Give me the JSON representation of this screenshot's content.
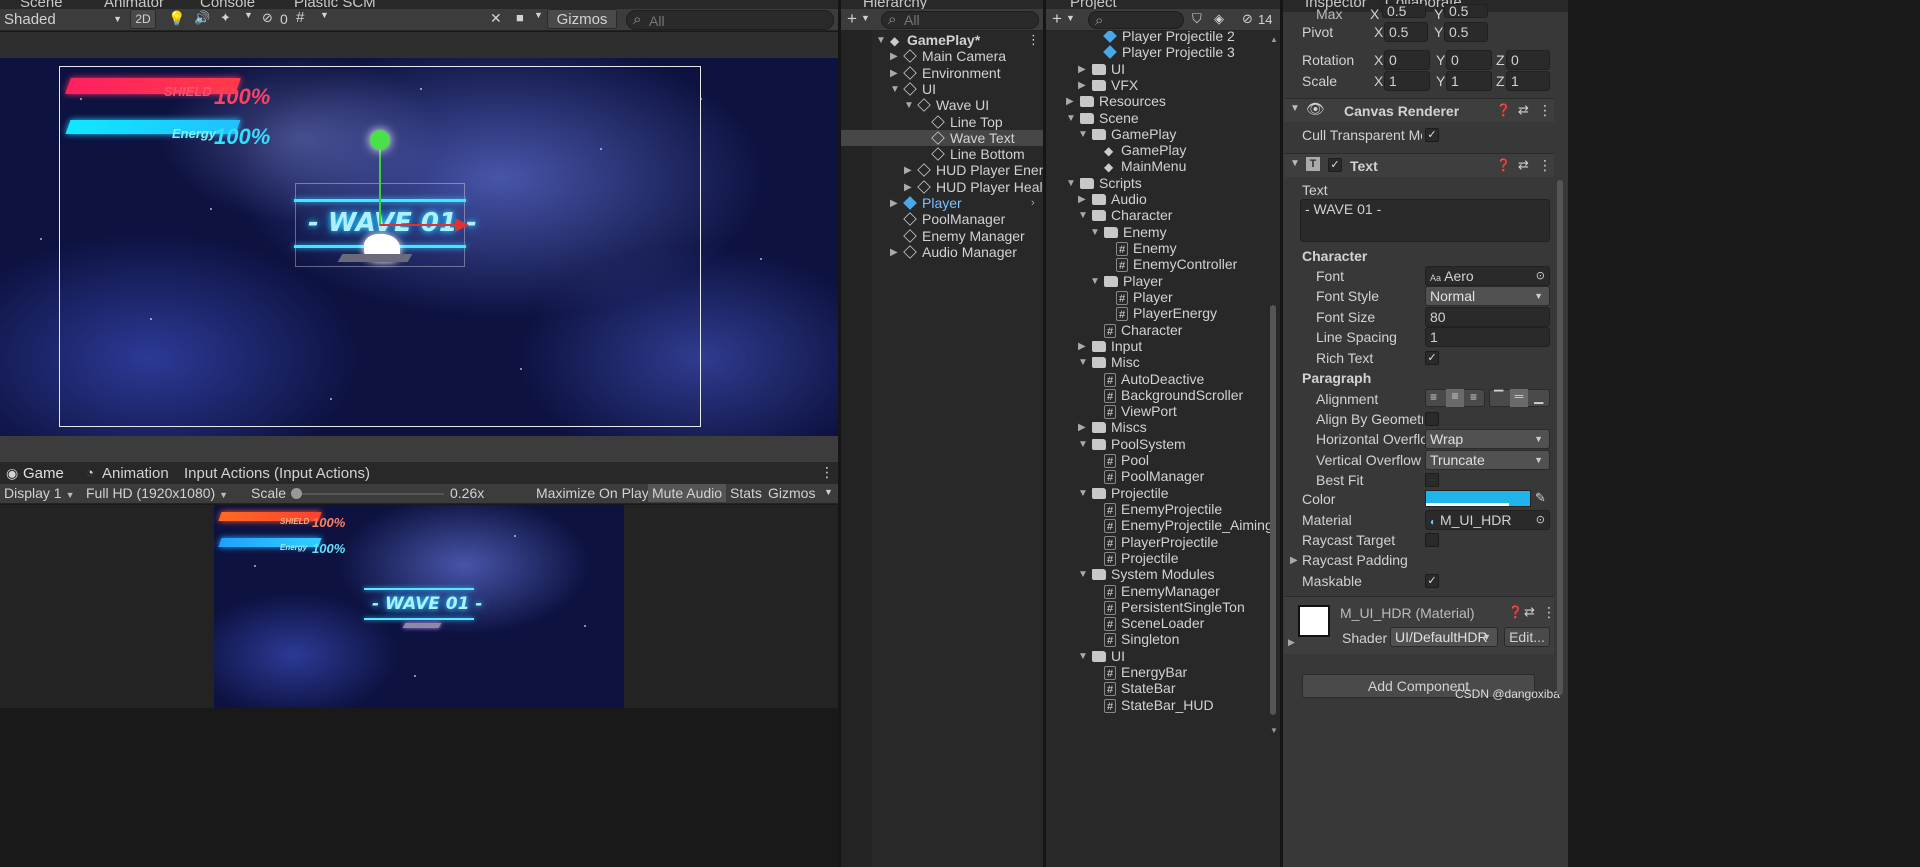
{
  "scene_panel": {
    "tabs": [
      "Scene",
      "Animator",
      "Console",
      "Plastic SCM"
    ],
    "shading_mode": "Shaded",
    "mode_2d": "2D",
    "hidden_count": "0",
    "gizmos_label": "Gizmos",
    "search_placeholder": "All",
    "hud": {
      "shield_label": "SHIELD",
      "shield_value": "100%",
      "energy_label": "Energy",
      "energy_value": "100%",
      "wave_text": "- WAVE 01 -"
    }
  },
  "game_panel": {
    "tabs": [
      "Game",
      "Animation",
      "Input Actions (Input Actions)"
    ],
    "display": "Display 1",
    "resolution": "Full HD (1920x1080)",
    "scale_label": "Scale",
    "scale_value": "0.26x",
    "scale_fraction": 0.0,
    "maximize_on_play": "Maximize On Play",
    "mute_audio": "Mute Audio",
    "stats": "Stats",
    "gizmos": "Gizmos",
    "hud": {
      "shield_label": "SHIELD",
      "shield_value": "100%",
      "energy_label": "Energy",
      "energy_value": "100%",
      "wave_text": "- WAVE 01 -"
    }
  },
  "hierarchy": {
    "title": "Hierarchy",
    "search_placeholder": "All",
    "items": [
      {
        "label": "GamePlay*",
        "depth": 0,
        "expanded": true,
        "icon": "unity-scene-icon",
        "bold": true
      },
      {
        "label": "Main Camera",
        "depth": 1,
        "expanded": false,
        "icon": "cube-icon"
      },
      {
        "label": "Environment",
        "depth": 1,
        "expanded": false,
        "icon": "cube-icon"
      },
      {
        "label": "UI",
        "depth": 1,
        "expanded": true,
        "icon": "cube-icon"
      },
      {
        "label": "Wave UI",
        "depth": 2,
        "expanded": true,
        "icon": "cube-icon"
      },
      {
        "label": "Line Top",
        "depth": 3,
        "icon": "cube-icon"
      },
      {
        "label": "Wave Text",
        "depth": 3,
        "icon": "cube-icon",
        "selected": true
      },
      {
        "label": "Line Bottom",
        "depth": 3,
        "icon": "cube-icon"
      },
      {
        "label": "HUD Player Energy",
        "depth": 2,
        "expanded": false,
        "icon": "cube-icon"
      },
      {
        "label": "HUD Player Health",
        "depth": 2,
        "expanded": false,
        "icon": "cube-icon"
      },
      {
        "label": "Player",
        "depth": 1,
        "expanded": false,
        "icon": "prefab-icon",
        "prefab": true
      },
      {
        "label": "PoolManager",
        "depth": 1,
        "icon": "cube-icon"
      },
      {
        "label": "Enemy Manager",
        "depth": 1,
        "icon": "cube-icon"
      },
      {
        "label": "Audio Manager",
        "depth": 1,
        "expanded": false,
        "icon": "cube-icon"
      }
    ]
  },
  "project": {
    "title": "Project",
    "badge_count": "14",
    "items": [
      {
        "label": "Player Projectile 2",
        "depth": 3,
        "icon": "prefab-icon"
      },
      {
        "label": "Player Projectile 3",
        "depth": 3,
        "icon": "prefab-icon"
      },
      {
        "label": "UI",
        "depth": 2,
        "expanded": false,
        "icon": "folder-icon"
      },
      {
        "label": "VFX",
        "depth": 2,
        "expanded": false,
        "icon": "folder-icon"
      },
      {
        "label": "Resources",
        "depth": 1,
        "expanded": false,
        "icon": "folder-icon"
      },
      {
        "label": "Scene",
        "depth": 1,
        "expanded": true,
        "icon": "folder-icon"
      },
      {
        "label": "GamePlay",
        "depth": 2,
        "expanded": true,
        "icon": "folder-icon"
      },
      {
        "label": "GamePlay",
        "depth": 3,
        "icon": "unity-scene-icon"
      },
      {
        "label": "MainMenu",
        "depth": 3,
        "icon": "unity-scene-icon"
      },
      {
        "label": "Scripts",
        "depth": 1,
        "expanded": true,
        "icon": "folder-icon"
      },
      {
        "label": "Audio",
        "depth": 2,
        "expanded": false,
        "icon": "folder-icon"
      },
      {
        "label": "Character",
        "depth": 2,
        "expanded": true,
        "icon": "folder-icon"
      },
      {
        "label": "Enemy",
        "depth": 3,
        "expanded": true,
        "icon": "folder-icon"
      },
      {
        "label": "Enemy",
        "depth": 4,
        "icon": "script-icon"
      },
      {
        "label": "EnemyController",
        "depth": 4,
        "icon": "script-icon"
      },
      {
        "label": "Player",
        "depth": 3,
        "expanded": true,
        "icon": "folder-icon"
      },
      {
        "label": "Player",
        "depth": 4,
        "icon": "script-icon"
      },
      {
        "label": "PlayerEnergy",
        "depth": 4,
        "icon": "script-icon"
      },
      {
        "label": "Character",
        "depth": 3,
        "icon": "script-icon"
      },
      {
        "label": "Input",
        "depth": 2,
        "expanded": false,
        "icon": "folder-icon"
      },
      {
        "label": "Misc",
        "depth": 2,
        "expanded": true,
        "icon": "folder-icon"
      },
      {
        "label": "AutoDeactive",
        "depth": 3,
        "icon": "script-icon"
      },
      {
        "label": "BackgroundScroller",
        "depth": 3,
        "icon": "script-icon"
      },
      {
        "label": "ViewPort",
        "depth": 3,
        "icon": "script-icon"
      },
      {
        "label": "Miscs",
        "depth": 2,
        "expanded": false,
        "icon": "folder-icon"
      },
      {
        "label": "PoolSystem",
        "depth": 2,
        "expanded": true,
        "icon": "folder-icon"
      },
      {
        "label": "Pool",
        "depth": 3,
        "icon": "script-icon"
      },
      {
        "label": "PoolManager",
        "depth": 3,
        "icon": "script-icon"
      },
      {
        "label": "Projectile",
        "depth": 2,
        "expanded": true,
        "icon": "folder-icon"
      },
      {
        "label": "EnemyProjectile",
        "depth": 3,
        "icon": "script-icon"
      },
      {
        "label": "EnemyProjectile_Aiming",
        "depth": 3,
        "icon": "script-icon"
      },
      {
        "label": "PlayerProjectile",
        "depth": 3,
        "icon": "script-icon"
      },
      {
        "label": "Projectile",
        "depth": 3,
        "icon": "script-icon"
      },
      {
        "label": "System Modules",
        "depth": 2,
        "expanded": true,
        "icon": "folder-icon"
      },
      {
        "label": "EnemyManager",
        "depth": 3,
        "icon": "script-icon"
      },
      {
        "label": "PersistentSingleTon",
        "depth": 3,
        "icon": "script-icon"
      },
      {
        "label": "SceneLoader",
        "depth": 3,
        "icon": "script-icon"
      },
      {
        "label": "Singleton",
        "depth": 3,
        "icon": "script-icon"
      },
      {
        "label": "UI",
        "depth": 2,
        "expanded": true,
        "icon": "folder-icon"
      },
      {
        "label": "EnergyBar",
        "depth": 3,
        "icon": "script-icon"
      },
      {
        "label": "StateBar",
        "depth": 3,
        "icon": "script-icon"
      },
      {
        "label": "StateBar_HUD",
        "depth": 3,
        "icon": "script-icon"
      }
    ]
  },
  "inspector": {
    "tabs": [
      "Inspector",
      "Collaborate"
    ],
    "max": {
      "label": "Max",
      "x": "0.5",
      "y": "0.5"
    },
    "pivot": {
      "label": "Pivot",
      "x": "0.5",
      "y": "0.5"
    },
    "rotation": {
      "label": "Rotation",
      "x": "0",
      "y": "0",
      "z": "0"
    },
    "scale": {
      "label": "Scale",
      "x": "1",
      "y": "1",
      "z": "1"
    },
    "canvas_renderer": {
      "title": "Canvas Renderer",
      "cull_label": "Cull Transparent Mes",
      "cull_checked": true
    },
    "text": {
      "title": "Text",
      "text_label": "Text",
      "text_value": "- WAVE 01 -",
      "character_header": "Character",
      "font_label": "Font",
      "font_value": "Aero",
      "font_style_label": "Font Style",
      "font_style_value": "Normal",
      "font_size_label": "Font Size",
      "font_size_value": "80",
      "line_spacing_label": "Line Spacing",
      "line_spacing_value": "1",
      "rich_text_label": "Rich Text",
      "paragraph_header": "Paragraph",
      "alignment_label": "Alignment",
      "align_geometry_label": "Align By Geometry",
      "h_overflow_label": "Horizontal Overflo",
      "h_overflow_value": "Wrap",
      "v_overflow_label": "Vertical Overflow",
      "v_overflow_value": "Truncate",
      "best_fit_label": "Best Fit",
      "color_label": "Color",
      "color_value": "#1fb4ea",
      "material_label": "Material",
      "material_value": "M_UI_HDR",
      "raycast_target_label": "Raycast Target",
      "raycast_padding_label": "Raycast Padding",
      "maskable_label": "Maskable"
    },
    "material": {
      "title": "M_UI_HDR (Material)",
      "shader_label": "Shader",
      "shader_value": "UI/DefaultHDR",
      "edit_label": "Edit..."
    },
    "add_component": "Add Component",
    "watermark": "CSDN @dangoxiba"
  }
}
